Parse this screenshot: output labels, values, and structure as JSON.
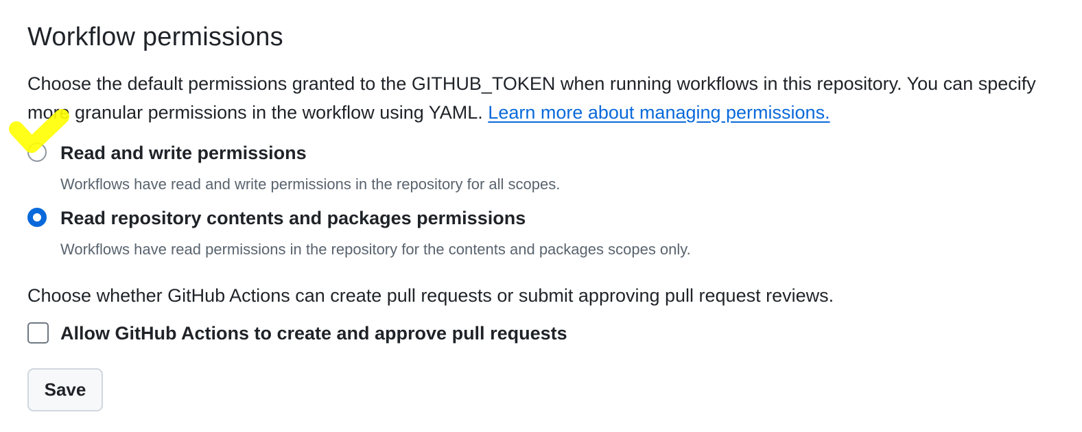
{
  "section": {
    "title": "Workflow permissions",
    "intro_text": "Choose the default permissions granted to the GITHUB_TOKEN when running workflows in this repository. You can specify more granular permissions in the workflow using YAML. ",
    "learn_more_link": "Learn more about managing permissions."
  },
  "permissions": {
    "options": [
      {
        "label": "Read and write permissions",
        "description": "Workflows have read and write permissions in the repository for all scopes.",
        "selected": false
      },
      {
        "label": "Read repository contents and packages permissions",
        "description": "Workflows have read permissions in the repository for the contents and packages scopes only.",
        "selected": true
      }
    ]
  },
  "pull_requests": {
    "prompt": "Choose whether GitHub Actions can create pull requests or submit approving pull request reviews.",
    "checkbox_label": "Allow GitHub Actions to create and approve pull requests",
    "checked": false
  },
  "actions": {
    "save_label": "Save"
  },
  "colors": {
    "accent": "#0969da",
    "text": "#1f2328",
    "muted": "#59636e",
    "highlight": "#ffff00"
  }
}
